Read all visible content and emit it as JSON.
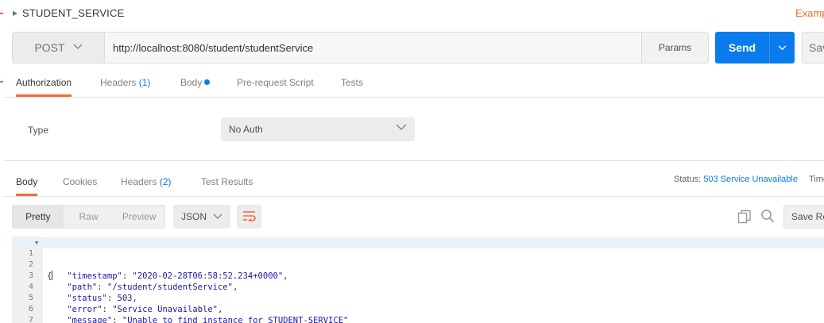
{
  "request": {
    "name": "STUDENT_SERVICE",
    "examples_label": "Examples",
    "method": "POST",
    "url": "http://localhost:8080/student/studentService",
    "params_label": "Params",
    "send_label": "Send",
    "save_label": "Save"
  },
  "request_tabs": [
    {
      "label": "Authorization",
      "active": true
    },
    {
      "label": "Headers",
      "count": "(1)"
    },
    {
      "label": "Body",
      "has_dot": true
    },
    {
      "label": "Pre-request Script"
    },
    {
      "label": "Tests"
    }
  ],
  "auth": {
    "type_label": "Type",
    "type_value": "No Auth"
  },
  "response_tabs": [
    {
      "label": "Body",
      "active": true
    },
    {
      "label": "Cookies"
    },
    {
      "label": "Headers",
      "count": "(2)"
    },
    {
      "label": "Test Results"
    }
  ],
  "response_meta": {
    "status_label": "Status:",
    "status_value": "503 Service Unavailable",
    "time_label": "Time"
  },
  "response_toolbar": {
    "views": [
      "Pretty",
      "Raw",
      "Preview"
    ],
    "active_view": "Pretty",
    "format": "JSON",
    "save_response_label": "Save Response"
  },
  "response_body": {
    "timestamp": "2020-02-28T06:58:52.234+0000",
    "path": "/student/studentService",
    "status": 503,
    "error": "Service Unavailable",
    "message": "Unable to find instance for STUDENT-SERVICE"
  },
  "colors": {
    "accent": "#f26b3a",
    "primary": "#097bed"
  },
  "icons": [
    "caret-right-icon",
    "chevron-down-icon",
    "wrap-lines-icon",
    "copy-icon",
    "search-icon",
    "fold-arrow-icon"
  ]
}
